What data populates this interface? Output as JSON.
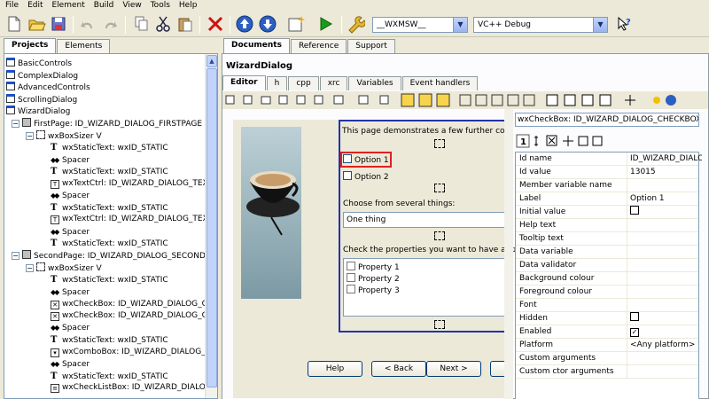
{
  "menu": [
    "File",
    "Edit",
    "Element",
    "Build",
    "View",
    "Tools",
    "Help"
  ],
  "toolbar": {
    "icons": [
      "new-file-icon",
      "open-folder-icon",
      "save-icon",
      "undo-icon",
      "redo-icon",
      "copy-icon",
      "cut-icon",
      "paste-icon",
      "delete-icon",
      "move-up-icon",
      "move-down-icon",
      "new-element-icon",
      "run-icon",
      "settings-wrench-icon",
      "help-context-icon"
    ],
    "platform_combo": "__WXMSW__",
    "config_combo": "VC++ Debug"
  },
  "left_tabs": [
    "Projects",
    "Elements"
  ],
  "tree": [
    {
      "label": "BasicControls"
    },
    {
      "label": "ComplexDialog"
    },
    {
      "label": "AdvancedControls"
    },
    {
      "label": "ScrollingDialog"
    },
    {
      "label": "WizardDialog"
    },
    {
      "label": "FirstPage: ID_WIZARD_DIALOG_FIRSTPAGE"
    },
    {
      "label": "wxBoxSizer V"
    },
    {
      "label": "wxStaticText: wxID_STATIC"
    },
    {
      "label": "Spacer"
    },
    {
      "label": "wxStaticText: wxID_STATIC"
    },
    {
      "label": "wxTextCtrl: ID_WIZARD_DIALOG_TEX"
    },
    {
      "label": "Spacer"
    },
    {
      "label": "wxStaticText: wxID_STATIC"
    },
    {
      "label": "wxTextCtrl: ID_WIZARD_DIALOG_TEX"
    },
    {
      "label": "Spacer"
    },
    {
      "label": "wxStaticText: wxID_STATIC"
    },
    {
      "label": "SecondPage: ID_WIZARD_DIALOG_SECONDP."
    },
    {
      "label": "wxBoxSizer V"
    },
    {
      "label": "wxStaticText: wxID_STATIC"
    },
    {
      "label": "Spacer"
    },
    {
      "label": "wxCheckBox: ID_WIZARD_DIALOG_C"
    },
    {
      "label": "wxCheckBox: ID_WIZARD_DIALOG_C"
    },
    {
      "label": "Spacer"
    },
    {
      "label": "wxStaticText: wxID_STATIC"
    },
    {
      "label": "wxComboBox: ID_WIZARD_DIALOG_C"
    },
    {
      "label": "Spacer"
    },
    {
      "label": "wxStaticText: wxID_STATIC"
    },
    {
      "label": "wxCheckListBox: ID_WIZARD_DIALOG"
    }
  ],
  "doc_tabs": [
    "Documents",
    "Reference",
    "Support"
  ],
  "doc_title": "WizardDialog",
  "editor_tabs": [
    "Editor",
    "h",
    "cpp",
    "xrc",
    "Variables",
    "Event handlers"
  ],
  "wizard": {
    "intro": "This page demonstrates a few further cont",
    "option1": "Option 1",
    "option2": "Option 2",
    "choose_label": "Choose from several things:",
    "combo_value": "One thing",
    "check_label": "Check the properties you want to have app",
    "properties": [
      "Property 1",
      "Property 2",
      "Property 3"
    ],
    "buttons": {
      "help": "Help",
      "back": "< Back",
      "next": "Next >"
    }
  },
  "properties_panel": {
    "element_selector": "wxCheckBox: ID_WIZARD_DIALOG_CHECKBOX",
    "rows": [
      {
        "name": "Id name",
        "value": "ID_WIZARD_DIALO"
      },
      {
        "name": "Id value",
        "value": "13015"
      },
      {
        "name": "Member variable name",
        "value": ""
      },
      {
        "name": "Label",
        "value": "Option 1"
      },
      {
        "name": "Initial value",
        "value": "",
        "checkbox": true,
        "checked": false
      },
      {
        "name": "Help text",
        "value": ""
      },
      {
        "name": "Tooltip text",
        "value": ""
      },
      {
        "name": "Data variable",
        "value": ""
      },
      {
        "name": "Data validator",
        "value": ""
      },
      {
        "name": "Background colour",
        "value": ""
      },
      {
        "name": "Foreground colour",
        "value": ""
      },
      {
        "name": "Font",
        "value": ""
      },
      {
        "name": "Hidden",
        "value": "",
        "checkbox": true,
        "checked": false
      },
      {
        "name": "Enabled",
        "value": "",
        "checkbox": true,
        "checked": true
      },
      {
        "name": "Platform",
        "value": "<Any platform>"
      },
      {
        "name": "Custom arguments",
        "value": ""
      },
      {
        "name": "Custom ctor arguments",
        "value": ""
      }
    ]
  },
  "colors": {
    "selection_red": "#e02020",
    "wizard_border": "#2233aa",
    "accent_blue": "#0a54c4"
  }
}
